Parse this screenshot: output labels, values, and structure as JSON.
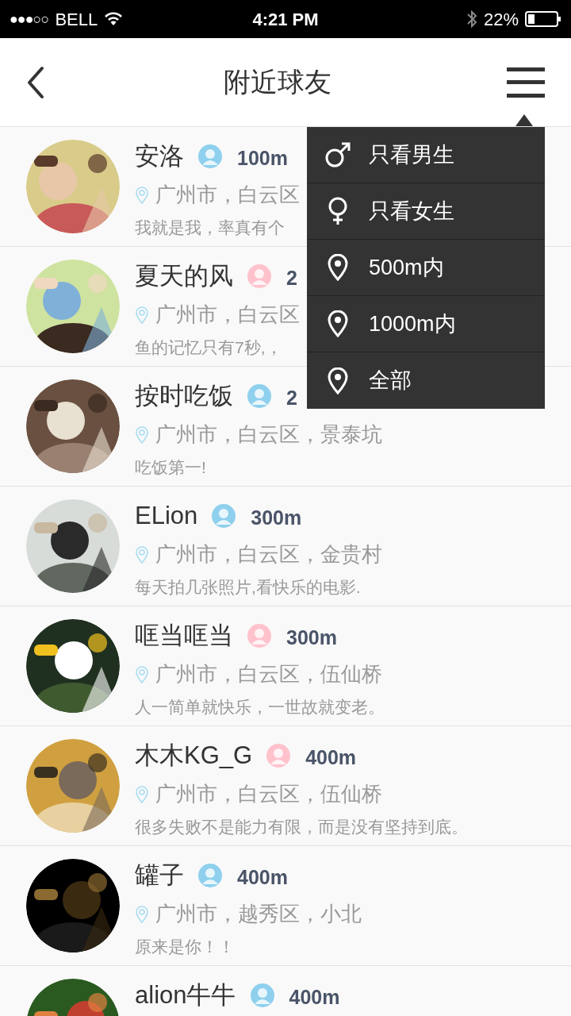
{
  "status_bar": {
    "signal_bars": "●●●○○",
    "carrier": "BELL",
    "time": "4:21 PM",
    "battery": "22%"
  },
  "nav": {
    "title": "附近球友"
  },
  "users": [
    {
      "name": "安洛",
      "color": "#8ed0ee",
      "distance": "100m",
      "location": "广州市，白云区",
      "bio": "我就是我，率真有个"
    },
    {
      "name": "夏天的风",
      "color": "#ffc2cc",
      "distance": "2",
      "location": "广州市，白云区",
      "bio": "鱼的记忆只有7秒,，"
    },
    {
      "name": "按时吃饭",
      "color": "#8ed0ee",
      "distance": "2",
      "location": "广州市，白云区，景泰坑",
      "bio": "吃饭第一!"
    },
    {
      "name": "ELion",
      "color": "#8ed0ee",
      "distance": "300m",
      "location": "广州市，白云区，金贵村",
      "bio": "每天拍几张照片,看快乐的电影."
    },
    {
      "name": "哐当哐当",
      "color": "#ffc2cc",
      "distance": "300m",
      "location": "广州市，白云区，伍仙桥",
      "bio": "人一简单就快乐，一世故就变老。"
    },
    {
      "name": "木木KG_G",
      "color": "#ffc2cc",
      "distance": "400m",
      "location": "广州市，白云区，伍仙桥",
      "bio": "很多失败不是能力有限，而是没有坚持到底。"
    },
    {
      "name": "罐子",
      "color": "#8ed0ee",
      "distance": "400m",
      "location": "广州市，越秀区，小北",
      "bio": "原来是你！！"
    },
    {
      "name": "alion牛牛",
      "color": "#8ed0ee",
      "distance": "400m"
    }
  ],
  "menu": {
    "items": [
      {
        "kind": "male",
        "label": "只看男生"
      },
      {
        "kind": "female",
        "label": "只看女生"
      },
      {
        "kind": "pin",
        "label": "500m内"
      },
      {
        "kind": "pin",
        "label": "1000m内"
      },
      {
        "kind": "pin",
        "label": "全部"
      }
    ]
  }
}
